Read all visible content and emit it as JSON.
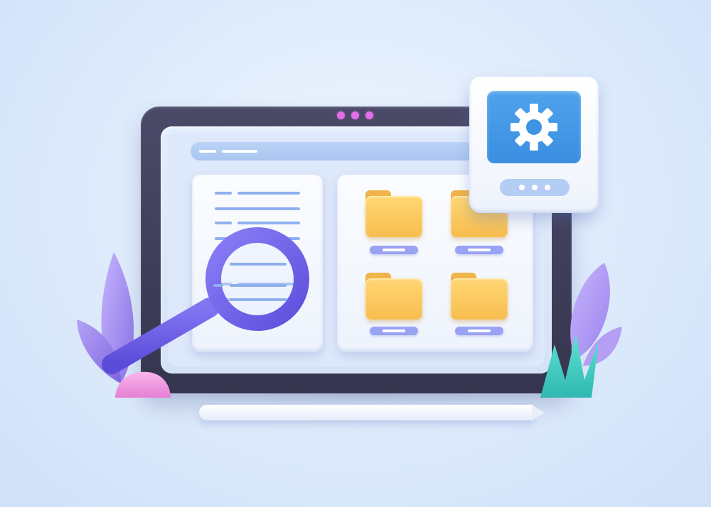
{
  "illustration": {
    "icons": {
      "magnifier": "magnifier-icon",
      "gear": "gear-icon",
      "folder": "folder-icon",
      "document": "document-icon",
      "plant": "plant-icon",
      "stylus": "stylus-icon"
    },
    "folders": [
      {
        "id": "folder-1"
      },
      {
        "id": "folder-2"
      },
      {
        "id": "folder-3"
      },
      {
        "id": "folder-4"
      }
    ],
    "colors": {
      "background": "#dbe9fb",
      "tablet_frame": "#3d3d58",
      "camera_dots": "#e36ee8",
      "folder": "#f7bd4e",
      "magnifier": "#6b5ce6",
      "settings_screen": "#3b8ee0",
      "plant_purple": "#a48cf0",
      "plant_teal": "#3fd0c4",
      "rock_pink": "#f49ae0"
    }
  }
}
